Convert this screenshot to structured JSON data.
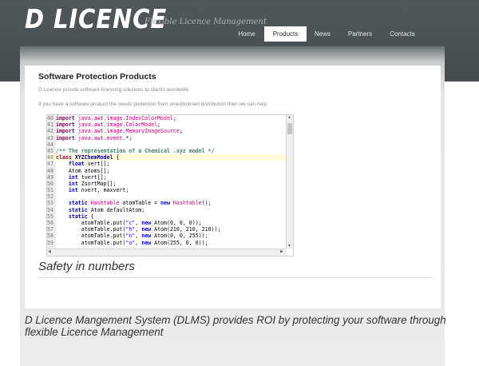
{
  "header": {
    "logo": "D LICENCE",
    "tagline": "Flexible Licence Management"
  },
  "nav": {
    "items": [
      {
        "label": "Home",
        "active": false
      },
      {
        "label": "Products",
        "active": true
      },
      {
        "label": "News",
        "active": false
      },
      {
        "label": "Partners",
        "active": false
      },
      {
        "label": "Contacts",
        "active": false
      }
    ]
  },
  "main": {
    "title": "Software Protection Products",
    "intro_1": "D Licence provde software licencing solutions to clients wordwide.",
    "intro_2": "If you have a software product the needs protection from unauthorised distribution then we can help",
    "section_heading": "Safety in numbers",
    "lead_text": "D Licence Mangement System (DLMS) provides ROI by protecting your software through flexible Licence Management"
  },
  "code_viewer": {
    "highlighted_line": "46",
    "lines": [
      {
        "num": "40",
        "tokens": [
          {
            "t": "import ",
            "c": "kw"
          },
          {
            "t": "java.awt.image.IndexColorModel",
            "c": "pink"
          },
          {
            "t": ";",
            "c": ""
          }
        ]
      },
      {
        "num": "41",
        "tokens": [
          {
            "t": "import ",
            "c": "kw"
          },
          {
            "t": "java.awt.image.ColorModel",
            "c": "pink"
          },
          {
            "t": ";",
            "c": ""
          }
        ]
      },
      {
        "num": "42",
        "tokens": [
          {
            "t": "import ",
            "c": "kw"
          },
          {
            "t": "java.awt.image.MemoryImageSource",
            "c": "pink"
          },
          {
            "t": ";",
            "c": ""
          }
        ]
      },
      {
        "num": "43",
        "tokens": [
          {
            "t": "import ",
            "c": "kw"
          },
          {
            "t": "java.awt.event.",
            "c": "pink"
          },
          {
            "t": "*;",
            "c": ""
          }
        ]
      },
      {
        "num": "44",
        "tokens": []
      },
      {
        "num": "45",
        "tokens": [
          {
            "t": "/** The representation of a Chemical .xyz model */",
            "c": "com"
          }
        ]
      },
      {
        "num": "46",
        "tokens": [
          {
            "t": "class ",
            "c": "kw"
          },
          {
            "t": "XYZChemModel ",
            "c": "id"
          },
          {
            "t": "{",
            "c": ""
          }
        ]
      },
      {
        "num": "47",
        "tokens": [
          {
            "t": "    ",
            "c": ""
          },
          {
            "t": "float ",
            "c": "blue"
          },
          {
            "t": "vert[];",
            "c": ""
          }
        ]
      },
      {
        "num": "48",
        "tokens": [
          {
            "t": "    Atom atoms[];",
            "c": ""
          }
        ]
      },
      {
        "num": "49",
        "tokens": [
          {
            "t": "    ",
            "c": ""
          },
          {
            "t": "int ",
            "c": "blue"
          },
          {
            "t": "tvert[];",
            "c": ""
          }
        ]
      },
      {
        "num": "50",
        "tokens": [
          {
            "t": "    ",
            "c": ""
          },
          {
            "t": "int ",
            "c": "blue"
          },
          {
            "t": "ZsortMap[];",
            "c": ""
          }
        ]
      },
      {
        "num": "51",
        "tokens": [
          {
            "t": "    ",
            "c": ""
          },
          {
            "t": "int ",
            "c": "blue"
          },
          {
            "t": "nvert, maxvert;",
            "c": ""
          }
        ]
      },
      {
        "num": "52",
        "tokens": []
      },
      {
        "num": "53",
        "tokens": [
          {
            "t": "    ",
            "c": ""
          },
          {
            "t": "static ",
            "c": "blue"
          },
          {
            "t": "Hashtable ",
            "c": "pink"
          },
          {
            "t": "atomTable = ",
            "c": ""
          },
          {
            "t": "new ",
            "c": "blue"
          },
          {
            "t": "Hashtable",
            "c": "pink"
          },
          {
            "t": "();",
            "c": ""
          }
        ]
      },
      {
        "num": "54",
        "tokens": [
          {
            "t": "    ",
            "c": ""
          },
          {
            "t": "static ",
            "c": "blue"
          },
          {
            "t": "Atom defaultAtom;",
            "c": ""
          }
        ]
      },
      {
        "num": "55",
        "tokens": [
          {
            "t": "    ",
            "c": ""
          },
          {
            "t": "static ",
            "c": "blue"
          },
          {
            "t": "{",
            "c": ""
          }
        ]
      },
      {
        "num": "56",
        "tokens": [
          {
            "t": "        atomTable.put(",
            "c": ""
          },
          {
            "t": "\"c\"",
            "c": "str"
          },
          {
            "t": ", ",
            "c": ""
          },
          {
            "t": "new ",
            "c": "blue"
          },
          {
            "t": "Atom(0, 0, 0));",
            "c": ""
          }
        ]
      },
      {
        "num": "57",
        "tokens": [
          {
            "t": "        atomTable.put(",
            "c": ""
          },
          {
            "t": "\"h\"",
            "c": "str"
          },
          {
            "t": ", ",
            "c": ""
          },
          {
            "t": "new ",
            "c": "blue"
          },
          {
            "t": "Atom(210, 210, 210));",
            "c": ""
          }
        ]
      },
      {
        "num": "58",
        "tokens": [
          {
            "t": "        atomTable.put(",
            "c": ""
          },
          {
            "t": "\"n\"",
            "c": "str"
          },
          {
            "t": ", ",
            "c": ""
          },
          {
            "t": "new ",
            "c": "blue"
          },
          {
            "t": "Atom(0, 0, 255));",
            "c": ""
          }
        ]
      },
      {
        "num": "59",
        "tokens": [
          {
            "t": "        atomTable.put(",
            "c": ""
          },
          {
            "t": "\"o\"",
            "c": "str"
          },
          {
            "t": ", ",
            "c": ""
          },
          {
            "t": "new ",
            "c": "blue"
          },
          {
            "t": "Atom(255, 0, 0));",
            "c": ""
          }
        ]
      }
    ]
  }
}
